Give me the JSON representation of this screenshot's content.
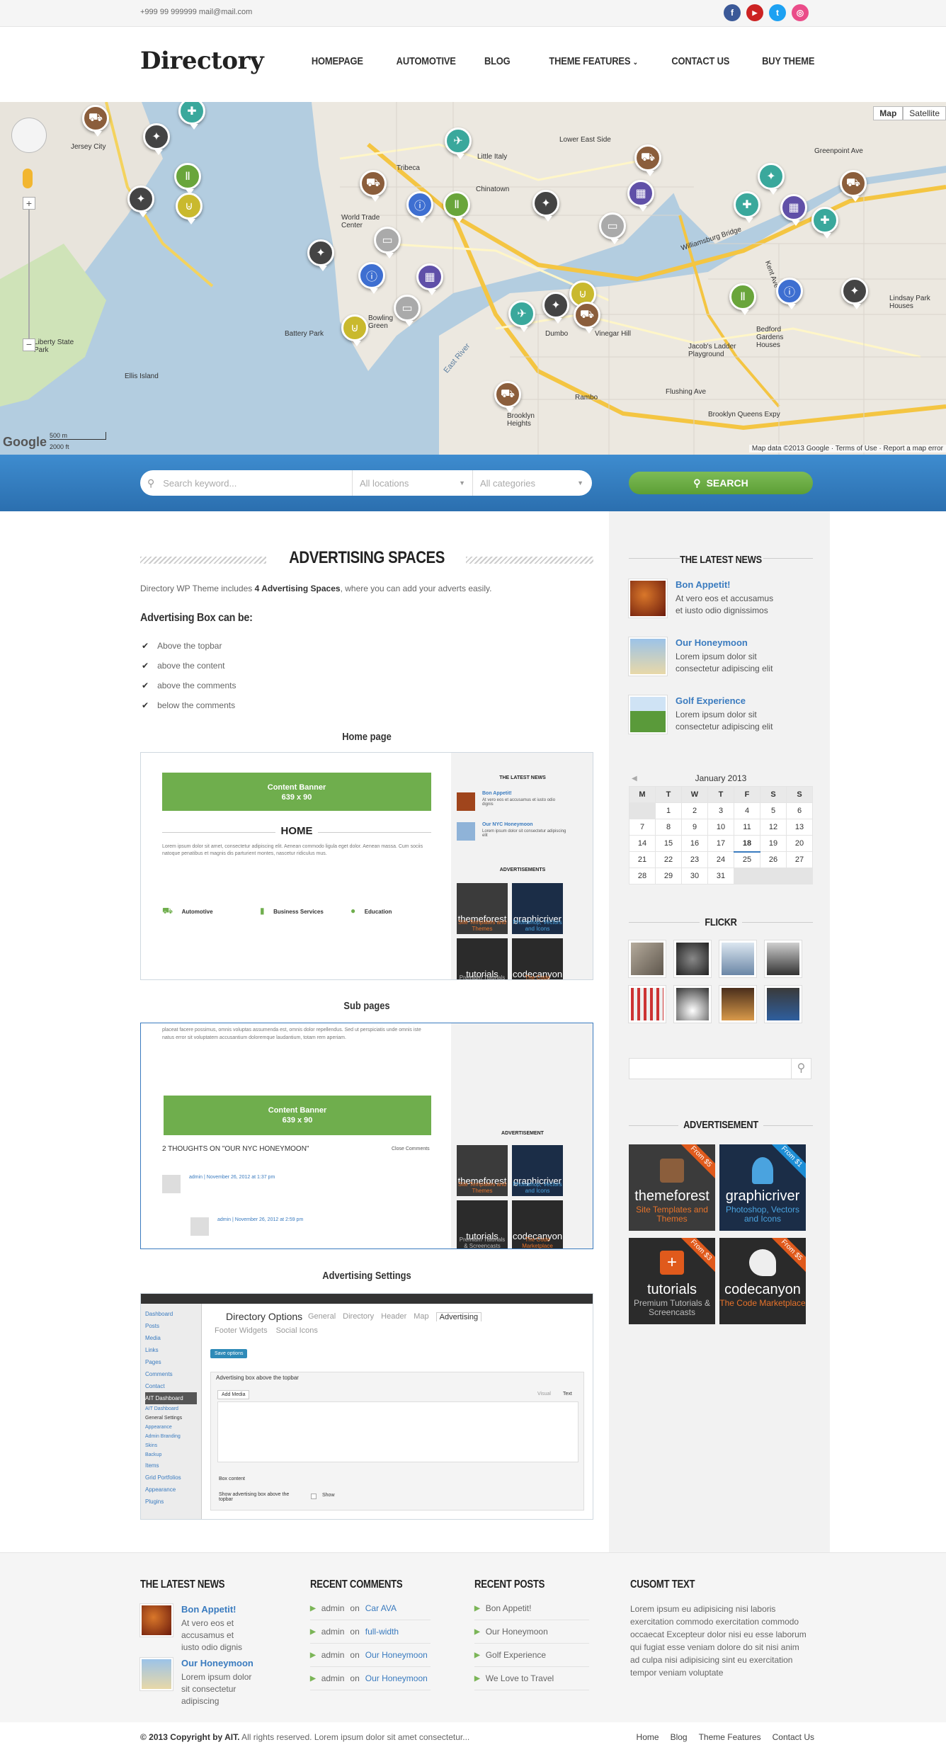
{
  "topbar": {
    "contact": "+999 99 999999 mail@mail.com"
  },
  "social": [
    "f",
    "▶",
    "t",
    "◎"
  ],
  "colors": {
    "accent_blue": "#3a7bbf",
    "green": "#6fae4d",
    "band_blue": "#2f78ba",
    "facebook": "#3b5998",
    "youtube": "#cc2222",
    "twitter": "#1da1f2",
    "dribbble": "#ea4c89"
  },
  "header": {
    "logo": "Directory",
    "nav": [
      "HOMEPAGE",
      "AUTOMOTIVE",
      "BLOG",
      "THEME FEATURES",
      "CONTACT US",
      "BUY THEME"
    ]
  },
  "map": {
    "toggle": [
      "Map",
      "Satellite"
    ],
    "labels": [
      "Jersey City",
      "Tribeca",
      "World Trade Center",
      "Chinatown",
      "Little Italy",
      "Lower East Side",
      "Battery Park",
      "Bowling Green",
      "Dumbo",
      "Vinegar Hill",
      "Williamsburg Bridge",
      "Greenpoint Ave",
      "Flushing Ave",
      "Brooklyn Queens Expy",
      "Liberty State Park",
      "Ellis Island",
      "East River",
      "Kent Ave",
      "Rambo",
      "Brooklyn Heights",
      "Bedford Gardens Houses",
      "Jacob's Ladder Playground",
      "Lindsay Park Houses"
    ],
    "scale": [
      "500 m",
      "2000 ft"
    ],
    "credits": "Map data ©2013 Google · Terms of Use · Report a map error",
    "google": "Google"
  },
  "search": {
    "keyword_placeholder": "Search keyword...",
    "location": "All locations",
    "category": "All categories",
    "button": "SEARCH"
  },
  "main": {
    "title": "ADVERTISING SPACES",
    "intro_pre": "Directory WP Theme includes ",
    "intro_bold": "4 Advertising Spaces",
    "intro_post": ", where you can add your adverts easily.",
    "box_title": "Advertising Box can be:",
    "checklist": [
      "Above the topbar",
      "above the content",
      "above the comments",
      "below the comments"
    ],
    "captions": [
      "Home page",
      "Sub pages",
      "Advertising Settings"
    ]
  },
  "preview_home": {
    "banner": [
      "Content Banner",
      "639 x 90"
    ],
    "home": "HOME",
    "latest": "THE LATEST NEWS",
    "news1": "Bon Appetit!",
    "news1_d": "At vero eos et accusamus et iusto odio dignis",
    "news2": "Our NYC Honeymoon",
    "news2_d": "Lorem ipsum dolor sit consectetur adipiscing elit",
    "advertisements": "ADVERTISEMENTS",
    "cols": [
      "Automotive",
      "Business Services",
      "Education"
    ],
    "lorem": "Lorem ipsum dolor sit amet, consectetur adipiscing elit. Aenean commodo ligula eget dolor. Aenean massa. Cum sociis natoque penatibus et magnis dis parturient montes, nascetur ridiculus mus."
  },
  "preview_sub": {
    "banner": [
      "Content Banner",
      "639 x 90"
    ],
    "thoughts": "2 THOUGHTS ON \"OUR NYC HONEYMOON\"",
    "close": "Close Comments",
    "admin1": "admin | November 26, 2012 at 1:37 pm",
    "admin2": "admin | November 26, 2012 at 2:59 pm",
    "advertisement": "ADVERTISEMENT",
    "text": "placeat facere possimus, omnis voluptas assumenda est, omnis dolor repellendus. Sed ut perspiciatis unde omnis iste natus error sit voluptatem accusantium doloremque laudantium, totam rem aperiam."
  },
  "preview_settings": {
    "title": "Directory Options",
    "tabs": [
      "General",
      "Directory",
      "Header",
      "Map",
      "Advertising"
    ],
    "tabs2": [
      "Footer Widgets",
      "Social Icons"
    ],
    "save": "Save options",
    "box": "Advertising box above the topbar",
    "add_media": "Add Media",
    "visual_text": [
      "Visual",
      "Text"
    ],
    "box_content": "Box content",
    "show_label": "Show advertising box above the topbar",
    "show": "Show",
    "menu": [
      "Dashboard",
      "Posts",
      "Media",
      "Links",
      "Pages",
      "Comments",
      "Contact",
      "AIT Dashboard",
      "AIT Dashboard",
      "General Settings",
      "Appearance",
      "Admin Branding",
      "Skins",
      "Backup",
      "Items",
      "Grid Portfolios",
      "Appearance",
      "Plugins"
    ]
  },
  "ads": [
    {
      "name": "themeforest",
      "sub": "Site Templates and Themes",
      "from": "From $5",
      "bg": "#3b3b3b"
    },
    {
      "name": "graphicriver",
      "sub": "Photoshop, Vectors and Icons",
      "from": "From $1",
      "bg": "#1b2d47"
    },
    {
      "name": "tutorials",
      "sub": "Premium Tutorials & Screencasts",
      "from": "From $3",
      "bg": "#2b2b2b"
    },
    {
      "name": "codecanyon",
      "sub": "The Code Marketplace",
      "from": "From $5",
      "bg": "#2a2a2a"
    }
  ],
  "sidebar": {
    "latest_title": "THE LATEST NEWS",
    "news": [
      {
        "title": "Bon Appetit!",
        "desc": "At vero eos et accusamus et iusto odio dignissimos"
      },
      {
        "title": "Our Honeymoon",
        "desc": "Lorem ipsum dolor sit consectetur adipiscing elit"
      },
      {
        "title": "Golf Experience",
        "desc": "Lorem ipsum dolor sit consectetur adipiscing elit"
      }
    ],
    "calendar": {
      "month": "January 2013",
      "days": [
        "M",
        "T",
        "W",
        "T",
        "F",
        "S",
        "S"
      ],
      "rows": [
        [
          "",
          "1",
          "2",
          "3",
          "4",
          "5",
          "6"
        ],
        [
          "7",
          "8",
          "9",
          "10",
          "11",
          "12",
          "13"
        ],
        [
          "14",
          "15",
          "16",
          "17",
          "18",
          "19",
          "20"
        ],
        [
          "21",
          "22",
          "23",
          "24",
          "25",
          "26",
          "27"
        ],
        [
          "28",
          "29",
          "30",
          "31",
          "",
          "",
          ""
        ]
      ],
      "today": "18"
    },
    "flickr_title": "FLICKR",
    "ads_title": "ADVERTISEMENT"
  },
  "footer": {
    "col_titles": [
      "THE LATEST NEWS",
      "RECENT COMMENTS",
      "RECENT POSTS",
      "CUSOMT TEXT"
    ],
    "news": [
      {
        "title": "Bon Appetit!",
        "desc": "At vero eos et accusamus et iusto odio dignis"
      },
      {
        "title": "Our Honeymoon",
        "desc": "Lorem ipsum dolor sit consectetur adipiscing"
      }
    ],
    "comments": [
      {
        "who": "admin",
        "on": "on",
        "link": "Car AVA"
      },
      {
        "who": "admin",
        "on": "on",
        "link": "full-width"
      },
      {
        "who": "admin",
        "on": "on",
        "link": "Our Honeymoon"
      },
      {
        "who": "admin",
        "on": "on",
        "link": "Our Honeymoon"
      }
    ],
    "posts": [
      "Bon Appetit!",
      "Our Honeymoon",
      "Golf Experience",
      "We Love to Travel"
    ],
    "custom_text": "Lorem ipsum eu adipisicing nisi laboris exercitation commodo exercitation commodo occaecat Excepteur dolor nisi eu esse laborum qui fugiat esse veniam dolore do sit nisi anim ad culpa nisi adipisicing sint eu exercitation tempor veniam voluptate"
  },
  "bottom": {
    "copy_bold": "© 2013 Copyright by AIT.",
    "copy_rest": " All rights reserved. Lorem ipsum dolor sit amet consectetur...",
    "links": [
      "Home",
      "Blog",
      "Theme Features",
      "Contact Us"
    ]
  }
}
